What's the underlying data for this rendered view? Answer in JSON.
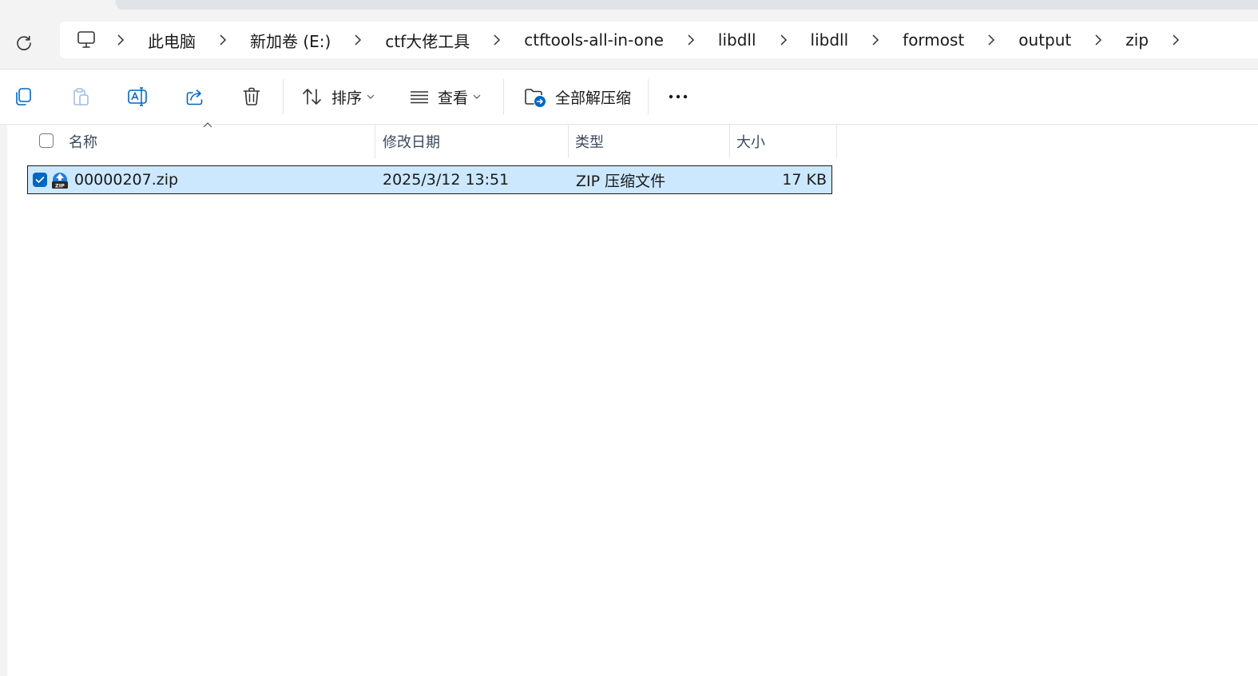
{
  "breadcrumb": {
    "items": [
      "此电脑",
      "新加卷 (E:)",
      "ctf大佬工具",
      "ctftools-all-in-one",
      "libdll",
      "libdll",
      "formost",
      "output",
      "zip"
    ]
  },
  "toolbar": {
    "sort_label": "排序",
    "view_label": "查看",
    "extract_label": "全部解压缩"
  },
  "columns": {
    "name": "名称",
    "modified": "修改日期",
    "type": "类型",
    "size": "大小"
  },
  "files": [
    {
      "name": "00000207.zip",
      "modified": "2025/3/12 13:51",
      "type": "ZIP 压缩文件",
      "size": "17 KB",
      "selected": true
    }
  ],
  "colors": {
    "accent": "#0067c0",
    "selection": "#cce8ff"
  }
}
